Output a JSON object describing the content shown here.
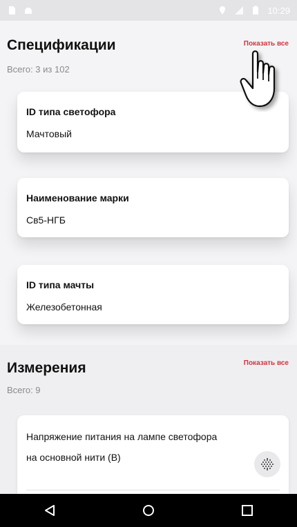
{
  "status_bar": {
    "time": "10:29",
    "icons": [
      "sd-card-icon",
      "android-icon",
      "location-icon",
      "signal-icon",
      "battery-icon"
    ]
  },
  "specifications": {
    "title": "Спецификации",
    "show_all": "Показать все",
    "count": "Всего: 3 из 102",
    "cards": [
      {
        "label": "ID типа светофора",
        "value": "Мачтовый"
      },
      {
        "label": "Наименование марки",
        "value": "Св5-НГБ"
      },
      {
        "label": "ID типа мачты",
        "value": "Железобетонная"
      }
    ]
  },
  "measurements": {
    "title": "Измерения",
    "show_all": "Показать все",
    "count": "Всего: 9",
    "card_text_line1": "Напряжение питания на лампе светофора",
    "card_text_line2": "на основной нити (В)"
  },
  "navbar": {
    "icons": [
      "back-icon",
      "home-icon",
      "recents-icon"
    ]
  },
  "colors": {
    "accent": "#d1343e",
    "background": "#f4f4f6",
    "muted_text": "#8a8a8e"
  }
}
